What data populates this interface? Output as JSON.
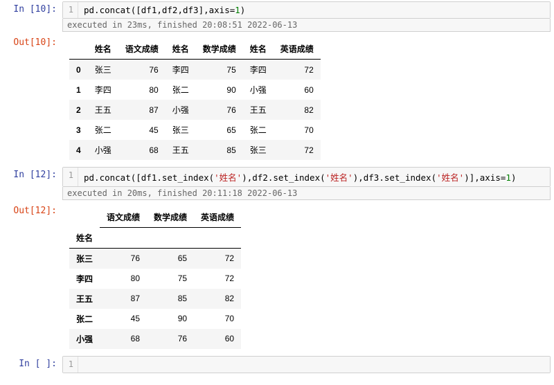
{
  "cells": {
    "c10": {
      "in_prompt": "In [10]:",
      "out_prompt": "Out[10]:",
      "lineno": "1",
      "code_pre": "pd.concat([df1,df2,df3],axis=",
      "code_num": "1",
      "code_post": ")",
      "exec_info": "executed in 23ms, finished 20:08:51 2022-06-13",
      "table": {
        "headers": [
          "",
          "姓名",
          "语文成绩",
          "姓名",
          "数学成绩",
          "姓名",
          "英语成绩"
        ],
        "rows": [
          {
            "idx": "0",
            "cells": [
              "张三",
              "76",
              "李四",
              "75",
              "李四",
              "72"
            ]
          },
          {
            "idx": "1",
            "cells": [
              "李四",
              "80",
              "张二",
              "90",
              "小强",
              "60"
            ]
          },
          {
            "idx": "2",
            "cells": [
              "王五",
              "87",
              "小强",
              "76",
              "王五",
              "82"
            ]
          },
          {
            "idx": "3",
            "cells": [
              "张二",
              "45",
              "张三",
              "65",
              "张二",
              "70"
            ]
          },
          {
            "idx": "4",
            "cells": [
              "小强",
              "68",
              "王五",
              "85",
              "张三",
              "72"
            ]
          }
        ]
      }
    },
    "c12": {
      "in_prompt": "In [12]:",
      "out_prompt": "Out[12]:",
      "lineno": "1",
      "code_parts": {
        "p1": "pd.concat([df1.set_index(",
        "s1": "'姓名'",
        "p2": "),df2.set_index(",
        "s2": "'姓名'",
        "p3": "),df3.set_index(",
        "s3": "'姓名'",
        "p4": ")],axis=",
        "num": "1",
        "p5": ")"
      },
      "exec_info": "executed in 20ms, finished 20:11:18 2022-06-13",
      "table": {
        "headers": [
          "",
          "语文成绩",
          "数学成绩",
          "英语成绩"
        ],
        "index_name": "姓名",
        "rows": [
          {
            "idx": "张三",
            "cells": [
              "76",
              "65",
              "72"
            ]
          },
          {
            "idx": "李四",
            "cells": [
              "80",
              "75",
              "72"
            ]
          },
          {
            "idx": "王五",
            "cells": [
              "87",
              "85",
              "82"
            ]
          },
          {
            "idx": "张二",
            "cells": [
              "45",
              "90",
              "70"
            ]
          },
          {
            "idx": "小强",
            "cells": [
              "68",
              "76",
              "60"
            ]
          }
        ]
      }
    },
    "c_empty": {
      "in_prompt": "In [ ]:",
      "lineno": "1"
    }
  }
}
